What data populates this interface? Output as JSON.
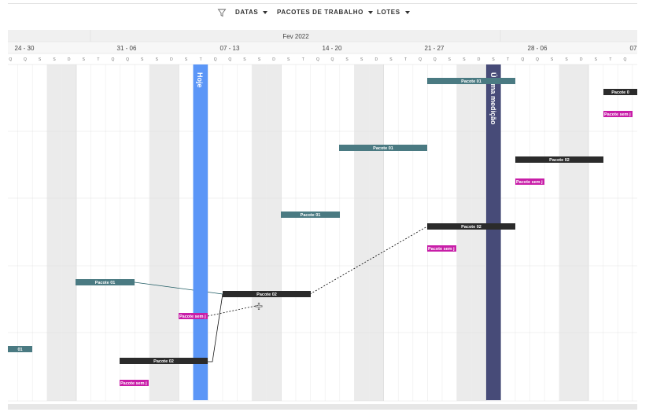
{
  "toolbar": {
    "filter_icon": "filter-icon",
    "datas": "DATAS",
    "pacotes": "PACOTES DE TRABALHO",
    "lotes": "LOTES"
  },
  "timeline": {
    "month": "Fev 2022",
    "weeks": [
      "24 - 30",
      "31 - 06",
      "07 - 13",
      "14 - 20",
      "21 - 27",
      "28 - 06",
      "07"
    ],
    "day_letters": [
      "Q",
      "Q",
      "S",
      "S",
      "D",
      "S",
      "T",
      "Q",
      "Q",
      "S",
      "S",
      "D",
      "S",
      "T",
      "Q",
      "Q",
      "S",
      "S",
      "D",
      "S",
      "T",
      "Q",
      "Q",
      "S",
      "S",
      "D",
      "S",
      "T",
      "Q",
      "Q",
      "S",
      "S",
      "D",
      "S",
      "T",
      "Q",
      "Q",
      "S",
      "S",
      "D",
      "S",
      "T",
      "Q",
      "Q",
      "S",
      "S",
      "D",
      "S",
      "T",
      "Q",
      "Q",
      "S",
      "S",
      "D",
      "S",
      "T",
      "Q"
    ]
  },
  "markers": {
    "today": "Hoje",
    "last_measure": "Última medição"
  },
  "colors": {
    "package_teal": "#4a7a82",
    "package_dark": "#2b2b2b",
    "pending_magenta": "#c81ea8",
    "today_blue": "#5b96f7",
    "last_measure_navy": "#474b78",
    "weekend_gray": "#ebebeb"
  },
  "bars": [
    {
      "label": "Pacote 01",
      "kind": "teal"
    },
    {
      "label": "Pacote 01",
      "kind": "teal"
    },
    {
      "label": "Pacote 01",
      "kind": "teal"
    },
    {
      "label": "Pacote 01",
      "kind": "teal"
    },
    {
      "label": "01",
      "kind": "teal"
    },
    {
      "label": "Pacote 0",
      "kind": "dark"
    },
    {
      "label": "Pacote 02",
      "kind": "dark"
    },
    {
      "label": "Pacote 02",
      "kind": "dark"
    },
    {
      "label": "Pacote 02",
      "kind": "dark"
    },
    {
      "label": "Pacote 02",
      "kind": "dark"
    },
    {
      "label": "Pacote sem j",
      "kind": "pending"
    },
    {
      "label": "Pacote sem j",
      "kind": "pending"
    },
    {
      "label": "Pacote sem j",
      "kind": "pending"
    },
    {
      "label": "Pacote sem j",
      "kind": "pending"
    },
    {
      "label": "Pacote sem j",
      "kind": "pending"
    }
  ]
}
